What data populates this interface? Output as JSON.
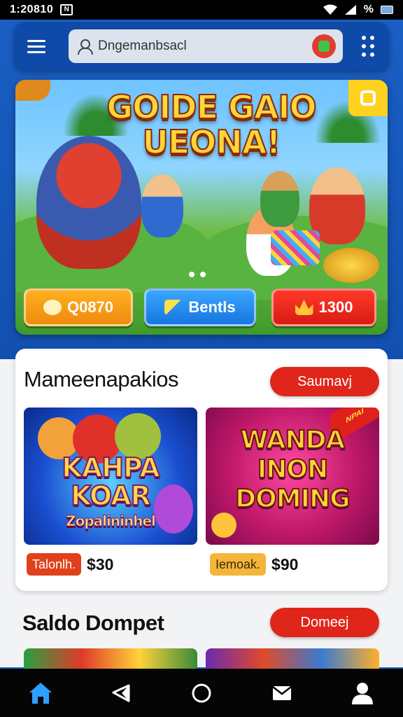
{
  "status_bar": {
    "time": "1:20810",
    "notification": "N"
  },
  "header": {
    "search_value": "Dngemanbsacl"
  },
  "banner": {
    "title_line1": "GOIDE GAIO",
    "title_line2": "UEONA!",
    "pills": [
      {
        "label": "Q0870",
        "color": "#f39a14"
      },
      {
        "label": "Bentls",
        "color": "#2a8ef0"
      },
      {
        "label": "1300",
        "color": "#e4241a"
      }
    ]
  },
  "section1": {
    "title": "Mameenapakios",
    "action_label": "Saumavj",
    "games": [
      {
        "title_line1": "KAHPA",
        "title_line2": "KOAR",
        "subtitle": "Zopalininhel",
        "tag": "Talonlh.",
        "tag_bg": "#e0401a",
        "price": "$30"
      },
      {
        "title_line1": "WANDA",
        "title_line2": "INON",
        "title_line3": "DOMING",
        "ribbon": "NPAI",
        "tag": "Iemoak.",
        "tag_bg": "#f4b63a",
        "price": "$90"
      }
    ]
  },
  "section2": {
    "title": "Saldo Dompet",
    "action_label": "Domeej"
  },
  "bottom_nav": [
    "home-icon",
    "send-icon",
    "circle-icon",
    "mail-icon",
    "profile-icon"
  ],
  "colors": {
    "primary": "#1565c8",
    "accent_red": "#e0261a",
    "active_nav": "#2fa0ff"
  }
}
